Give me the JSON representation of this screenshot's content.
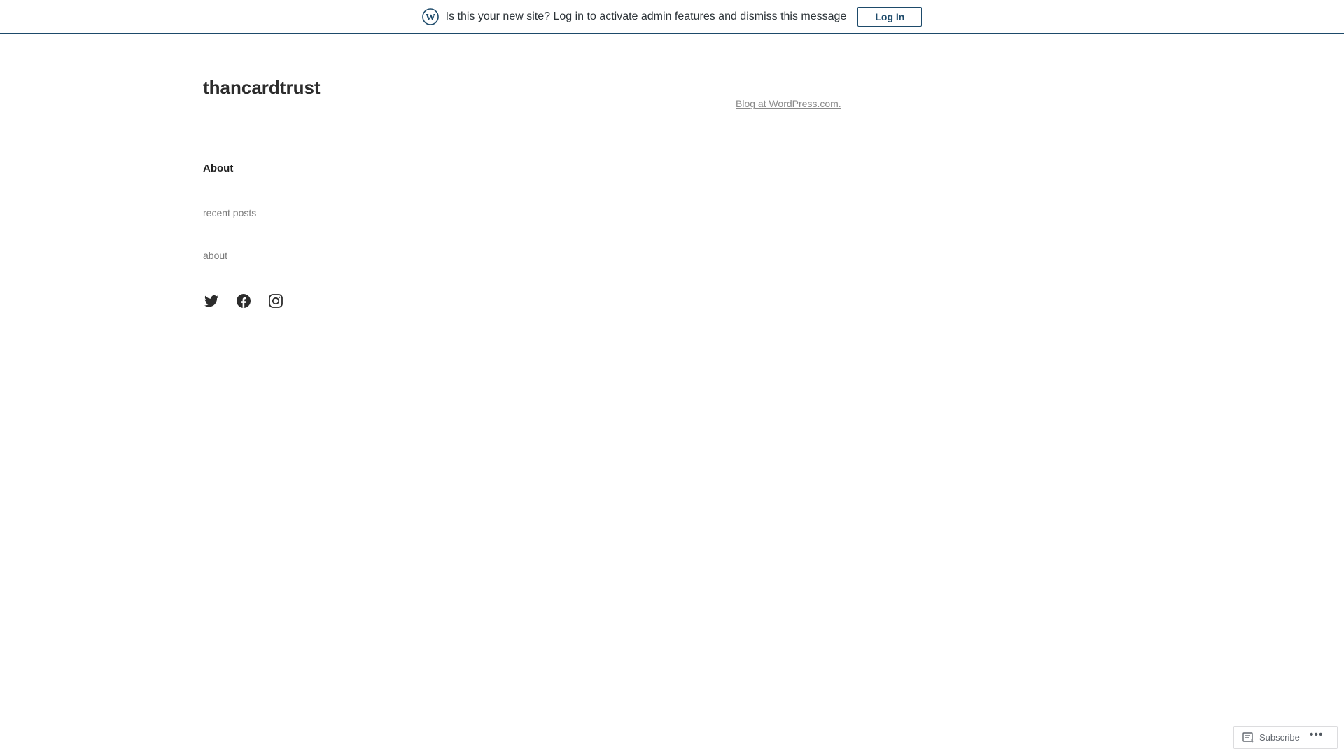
{
  "banner": {
    "message": "Is this your new site? Log in to activate admin features and dismiss this message",
    "login_label": "Log In",
    "icon": "wordpress-logo-icon"
  },
  "site": {
    "title": "thancardtrust"
  },
  "footer": {
    "credit": "Blog at WordPress.com."
  },
  "nav": {
    "heading": "About",
    "items": [
      {
        "label": "recent posts"
      },
      {
        "label": "about"
      }
    ]
  },
  "socials": [
    {
      "name": "twitter-icon"
    },
    {
      "name": "facebook-icon"
    },
    {
      "name": "instagram-icon"
    }
  ],
  "action_bar": {
    "subscribe_label": "Subscribe",
    "more_label": "•••"
  },
  "colors": {
    "accent": "#1d4a6a",
    "title": "#2c2c2c",
    "muted": "#7a7a7a"
  }
}
